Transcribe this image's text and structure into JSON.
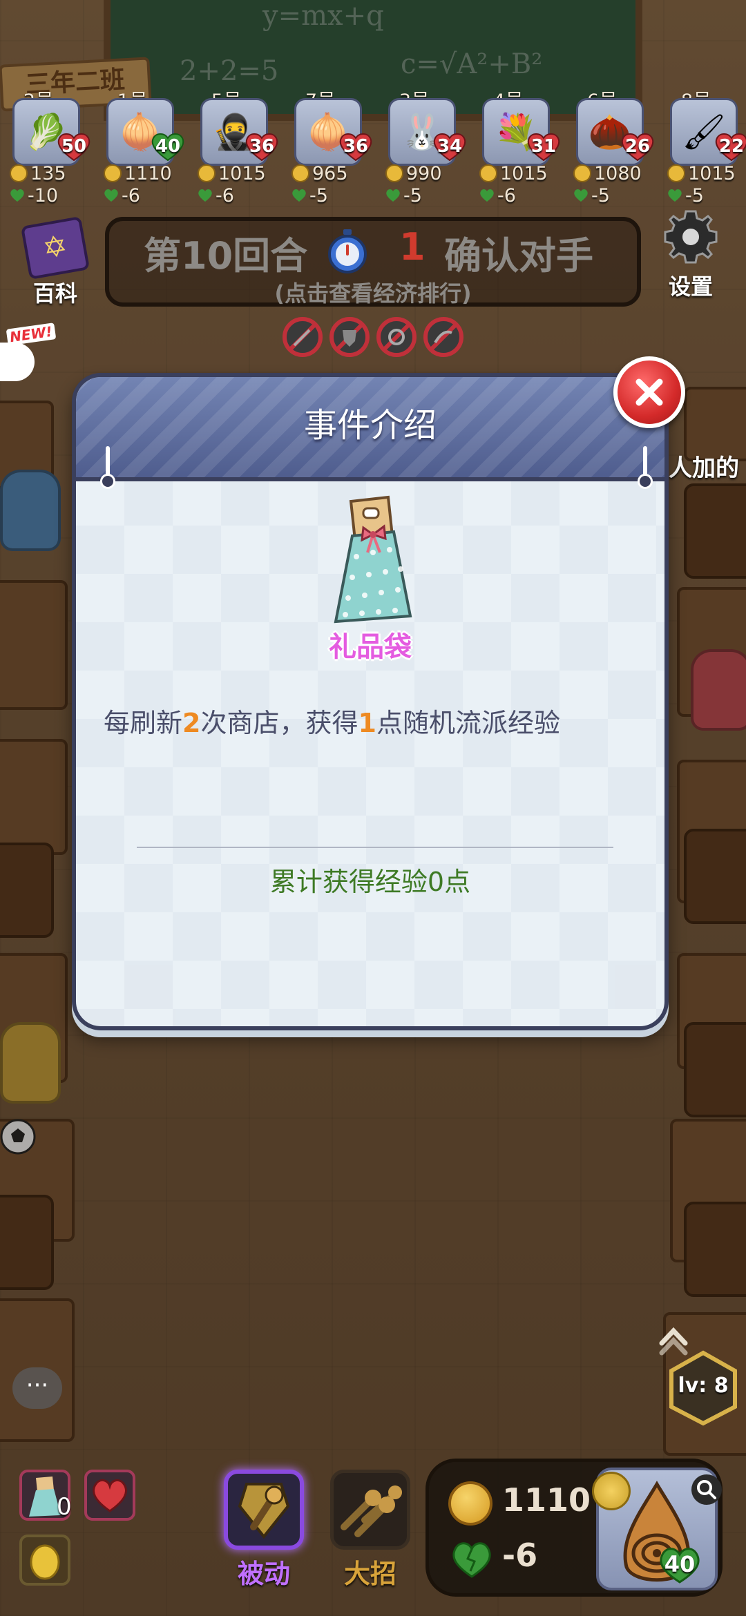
{
  "players": [
    {
      "num": "2号",
      "hp": "50",
      "coins": "135",
      "delta": "-10",
      "icon": "cabbage-avatar",
      "emoji": "🥬"
    },
    {
      "num": "1号",
      "hp": "40",
      "coins": "1110",
      "delta": "-6",
      "icon": "onion-target-avatar",
      "emoji": "🧅"
    },
    {
      "num": "5号",
      "hp": "36",
      "coins": "1015",
      "delta": "-6",
      "icon": "blue-ninja-avatar",
      "emoji": "🥷"
    },
    {
      "num": "7号",
      "hp": "36",
      "coins": "965",
      "delta": "-5",
      "icon": "onion-target-avatar",
      "emoji": "🧅"
    },
    {
      "num": "3号",
      "hp": "34",
      "coins": "990",
      "delta": "-5",
      "icon": "rabbit-avatar",
      "emoji": "🐰"
    },
    {
      "num": "4号",
      "hp": "31",
      "coins": "1015",
      "delta": "-6",
      "icon": "flower-bouquet-avatar",
      "emoji": "💐"
    },
    {
      "num": "6号",
      "hp": "26",
      "coins": "1080",
      "delta": "-5",
      "icon": "pinecone-avatar",
      "emoji": "🌰"
    },
    {
      "num": "8号",
      "hp": "22",
      "coins": "1015",
      "delta": "-5",
      "icon": "brush-avatar",
      "emoji": "🖌"
    }
  ],
  "background": {
    "class_sign": "三年二班",
    "chalk_formula_1": "y=mx+q",
    "chalk_formula_2": "c=√A²+B²",
    "chalk_formula_3": "2+2=5"
  },
  "top_bar": {
    "wiki_label": "百科",
    "round_title": "第10回合",
    "timer": "1",
    "status": "确认对手",
    "subtitle": "(点击查看经济排行)",
    "settings_label": "设置",
    "new_tag": "NEW!",
    "side_text": "人加的"
  },
  "modal": {
    "title": "事件介绍",
    "item_name": "礼品袋",
    "desc_part1": "每刷新",
    "desc_num1": "2",
    "desc_part2": "次商店，获得",
    "desc_num2": "1",
    "desc_part3": "点随机流派经验",
    "total_exp": "累计获得经验0点"
  },
  "hud": {
    "chat_icon": "···",
    "level": "lv: 8",
    "slot_count": "0",
    "passive_label": "被动",
    "ult_label": "大招",
    "coins": "1110",
    "hp_delta": "-6",
    "avatar_hp": "40"
  },
  "colors": {
    "modal_header": "#5f6d9e",
    "close_red": "#d42a2a",
    "highlight_orange": "#ee8a22",
    "exp_green": "#3e7a25",
    "item_pink": "#e45ce0",
    "timer_red": "#d13b2e"
  }
}
